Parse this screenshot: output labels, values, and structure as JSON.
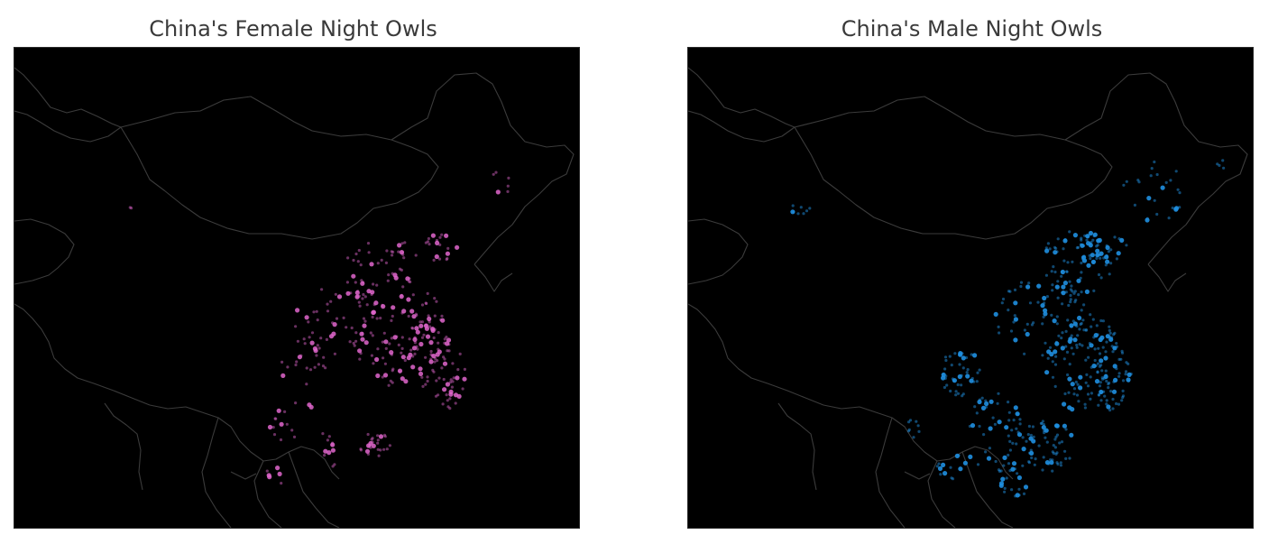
{
  "maps": [
    {
      "title": "China's Female Night Owls",
      "dot_color": "#e066cc",
      "background": "#000000",
      "border_color": "#3b3b3b",
      "note": "",
      "points": []
    },
    {
      "title": "China's Male Night Owls",
      "dot_color": "#1f8fe0",
      "background": "#000000",
      "border_color": "#3b3b3b",
      "note": "",
      "points": []
    }
  ]
}
